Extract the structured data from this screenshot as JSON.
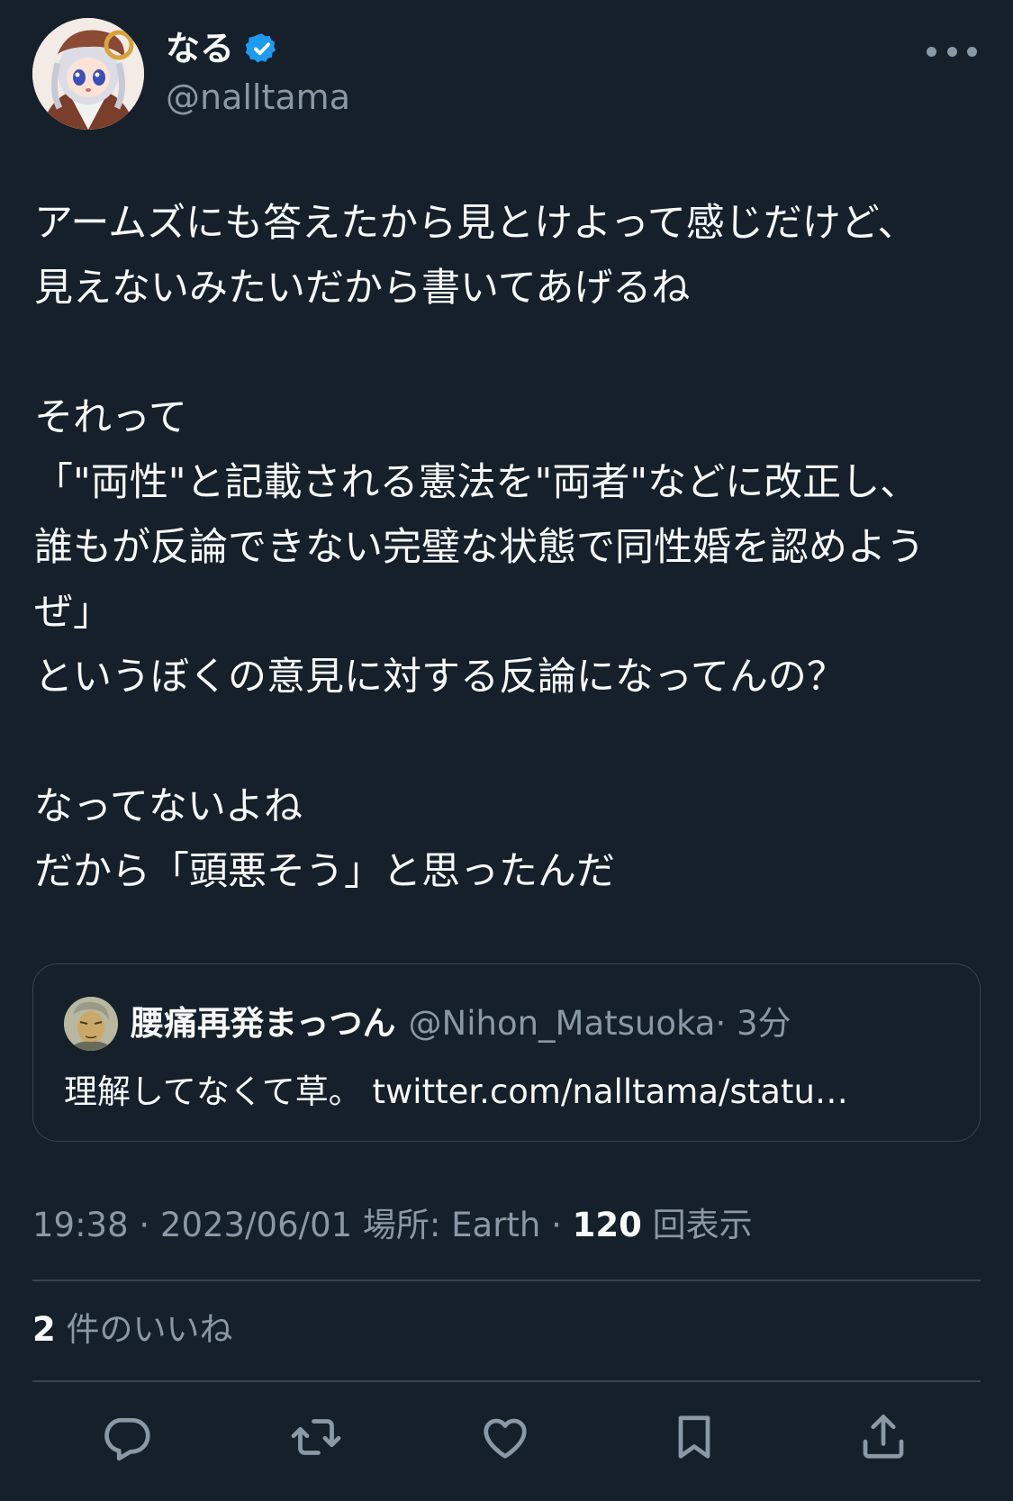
{
  "author": {
    "display_name": "なる",
    "handle": "@nalltama",
    "verified": true,
    "avatar_icon": "anime-character-avatar"
  },
  "tweet": {
    "lines": [
      "アームズにも答えたから見とけよって感じだけど、",
      "見えないみたいだから書いてあげるね",
      "",
      "それって",
      "「\"両性\"と記載される憲法を\"両者\"などに改正し、",
      "誰もが反論できない完璧な状態で同性婚を認めよう",
      "ぜ」",
      "というぼくの意見に対する反論になってんの？",
      "",
      "なってないよね",
      "だから「頭悪そう」と思ったんだ"
    ]
  },
  "quote": {
    "display_name": "腰痛再発まっつん",
    "handle": "@Nihon_Matsuoka",
    "time": " · 3分",
    "text": "理解してなくて草。 twitter.com/nalltama/statu…",
    "avatar_icon": "illustrated-man-avatar"
  },
  "meta": {
    "time": "19:38 · 2023/06/01 場所: Earth · ",
    "views_count": "120",
    "views_label": " 回表示"
  },
  "likes": {
    "count": "2",
    "label": " 件のいいね"
  },
  "actions": {
    "reply_icon": "reply-icon",
    "retweet_icon": "retweet-icon",
    "like_icon": "like-icon",
    "bookmark_icon": "bookmark-icon",
    "share_icon": "share-icon"
  },
  "colors": {
    "background": "#15202b",
    "text": "#f7f9f9",
    "secondary": "#8b98a5",
    "border": "#38444d",
    "verified": "#1d9bf0"
  }
}
